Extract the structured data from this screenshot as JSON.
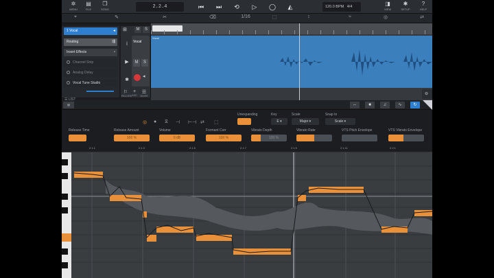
{
  "toolbar": {
    "left_buttons": [
      {
        "icon": "✲",
        "label": "MENU"
      },
      {
        "icon": "▤",
        "label": "FILE"
      },
      {
        "icon": "❐",
        "label": "SONG"
      }
    ],
    "position": "2.2.4",
    "tempo": {
      "bpm": "120.0 BPM",
      "sig": "4/4"
    },
    "right_buttons": [
      {
        "icon": "◨",
        "label": "VIEW"
      },
      {
        "icon": "✱",
        "label": "SETUP"
      },
      {
        "icon": "?",
        "label": "HELP"
      }
    ]
  },
  "tools": {
    "snap_label": "1/16",
    "items": [
      "⌖",
      "✎",
      "✂",
      "⌫",
      "⬚",
      "↕",
      "≈",
      "◎",
      "⇄"
    ]
  },
  "tracklist": {
    "track": "1 Vocal",
    "routing": "Routing",
    "insert": "Insert Effects",
    "effects": [
      "Channel Strip",
      "Analog Delay",
      "Vocal Tune Studio"
    ],
    "footer": "LIST"
  },
  "channel": {
    "name": "Vocal",
    "mute": "M",
    "solo": "S",
    "footer": [
      {
        "icon": "⚐",
        "label": "RECORD"
      },
      {
        "icon": "+",
        "label": "ADD"
      },
      {
        "icon": "☰",
        "label": "MIXER"
      }
    ]
  },
  "arrange": {
    "clip_name": "Vocal"
  },
  "melodyne": {
    "labels": {
      "unexpanding": "Unexpanding",
      "key": "Key",
      "scale": "Scale",
      "snap": "Snap to",
      "release_time": "Release Time",
      "release_amount": "Release Amount",
      "volume": "Volume",
      "formant": "Formant Corr",
      "vibrato": "Vibrato Depth",
      "vibrato_rate": "Vibrato Rate",
      "pitch_env": "VTS Pitch Envelope",
      "vib_env": "VTS Vibrato Envelope"
    },
    "values": {
      "unexpanding": "",
      "key": "E",
      "scale": "Major",
      "snap": "Scale",
      "release_time": "",
      "release_amount": "100 %",
      "volume": "0 dB",
      "formant": "100 %",
      "vibrato": "100 %",
      "vibrato_rate": "",
      "pitch_env": "",
      "vib_env": ""
    },
    "ruler": [
      "2.1.1",
      "2.1.3",
      "2.1.5",
      "2.1.7",
      "2.1.9",
      "2.1.11",
      "2.2.1"
    ]
  },
  "colors": {
    "accent": "#2f7fd0",
    "note": "#e8913a",
    "wave": "#3c7fbd"
  }
}
